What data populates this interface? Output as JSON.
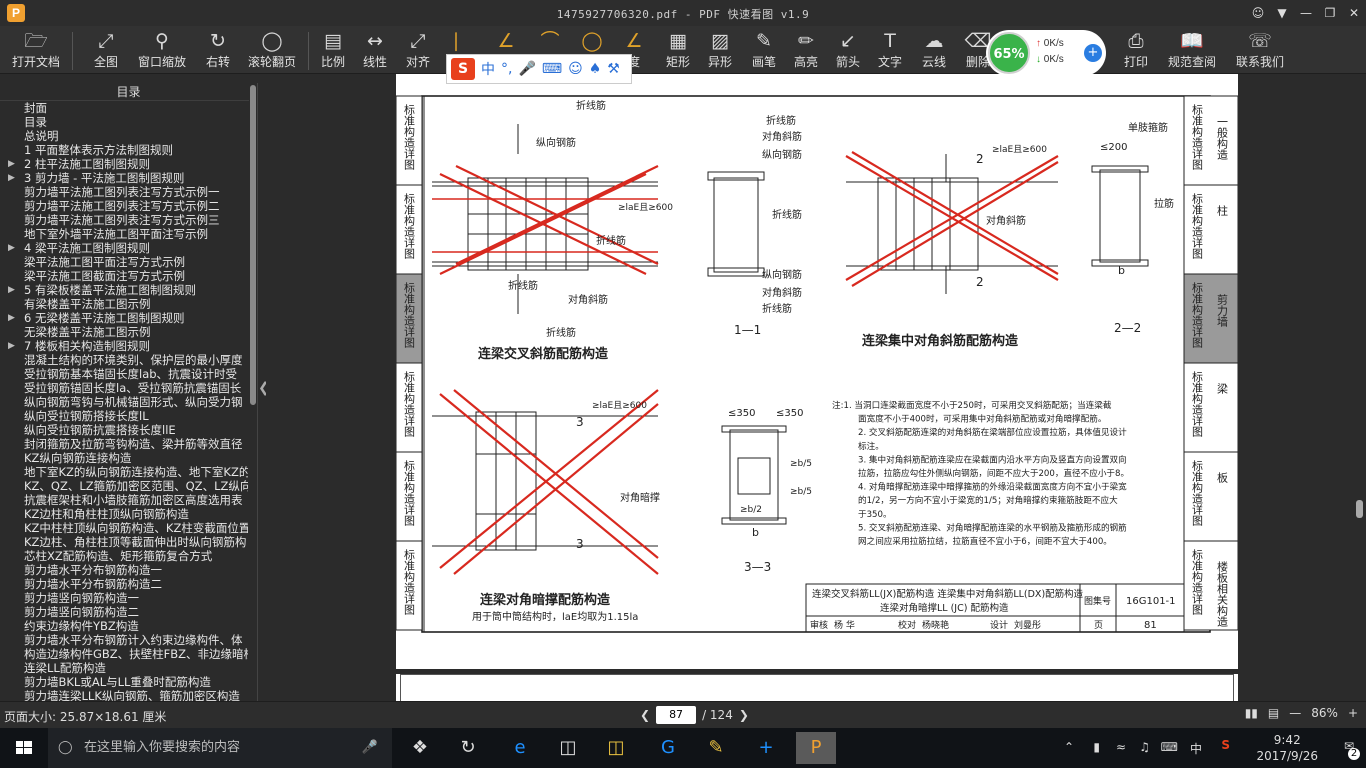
{
  "window": {
    "title": "1475927706320.pdf - PDF 快速看图 v1.9",
    "app_icon_letter": "P"
  },
  "toolbar": {
    "open": "打开文档",
    "fit": "全图",
    "window_zoom": "窗口缩放",
    "rotate": "右转",
    "scroll_page": "滚轮翻页",
    "scale": "比例",
    "linear": "线性",
    "align": "对齐",
    "degree": "度",
    "rect": "矩形",
    "shape": "异形",
    "pen": "画笔",
    "highlight": "高亮",
    "arrow": "箭头",
    "text": "文字",
    "cloud": "云线",
    "delete": "删除",
    "print": "打印",
    "spec": "规范查阅",
    "contact": "联系我们"
  },
  "ime": {
    "label": "中"
  },
  "net_widget": {
    "percent": "65%",
    "up": "0K/s",
    "down": "0K/s"
  },
  "sidebar": {
    "header": "目录",
    "items": [
      {
        "label": "封面",
        "arrow": ""
      },
      {
        "label": "目录",
        "arrow": ""
      },
      {
        "label": "总说明",
        "arrow": ""
      },
      {
        "label": "1 平面整体表示方法制图规则",
        "arrow": ""
      },
      {
        "label": "2 柱平法施工图制图规则",
        "arrow": "▶"
      },
      {
        "label": "3 剪力墙 - 平法施工图制图规则",
        "arrow": "▶"
      },
      {
        "label": "剪力墙平法施工图列表注写方式示例一",
        "arrow": ""
      },
      {
        "label": "剪力墙平法施工图列表注写方式示例二",
        "arrow": ""
      },
      {
        "label": "剪力墙平法施工图列表注写方式示例三",
        "arrow": ""
      },
      {
        "label": "地下室外墙平法施工图平面注写示例",
        "arrow": ""
      },
      {
        "label": "4 梁平法施工图制图规则",
        "arrow": "▶"
      },
      {
        "label": "梁平法施工图平面注写方式示例",
        "arrow": ""
      },
      {
        "label": "梁平法施工图截面注写方式示例",
        "arrow": ""
      },
      {
        "label": "5 有梁板楼盖平法施工图制图规则",
        "arrow": "▶"
      },
      {
        "label": "有梁楼盖平法施工图示例",
        "arrow": ""
      },
      {
        "label": "6 无梁楼盖平法施工图制图规则",
        "arrow": "▶"
      },
      {
        "label": "无梁楼盖平法施工图示例",
        "arrow": ""
      },
      {
        "label": "7 楼板相关构造制图规则",
        "arrow": "▶"
      },
      {
        "label": "混凝土结构的环境类别、保护层的最小厚度",
        "arrow": ""
      },
      {
        "label": "受拉钢筋基本锚固长度lab、抗震设计时受",
        "arrow": ""
      },
      {
        "label": "受拉钢筋锚固长度la、受拉钢筋抗震锚固长",
        "arrow": ""
      },
      {
        "label": "纵向钢筋弯钩与机械锚固形式、纵向受力钢",
        "arrow": ""
      },
      {
        "label": "纵向受拉钢筋搭接长度lL",
        "arrow": ""
      },
      {
        "label": "纵向受拉钢筋抗震搭接长度llE",
        "arrow": ""
      },
      {
        "label": "封闭箍筋及拉筋弯钩构造、梁并筋等效直径",
        "arrow": ""
      },
      {
        "label": "KZ纵向钢筋连接构造",
        "arrow": ""
      },
      {
        "label": "地下室KZ的纵向钢筋连接构造、地下室KZ的",
        "arrow": ""
      },
      {
        "label": "KZ、QZ、LZ箍筋加密区范围、QZ、LZ纵向钢",
        "arrow": ""
      },
      {
        "label": "抗震框架柱和小墙肢箍筋加密区高度选用表",
        "arrow": ""
      },
      {
        "label": "KZ边柱和角柱柱顶纵向钢筋构造",
        "arrow": ""
      },
      {
        "label": "KZ中柱柱顶纵向钢筋构造、KZ柱变截面位置",
        "arrow": ""
      },
      {
        "label": "KZ边柱、角柱柱顶等截面伸出时纵向钢筋构",
        "arrow": ""
      },
      {
        "label": "芯柱XZ配筋构造、矩形箍筋复合方式",
        "arrow": ""
      },
      {
        "label": "剪力墙水平分布钢筋构造一",
        "arrow": ""
      },
      {
        "label": "剪力墙水平分布钢筋构造二",
        "arrow": ""
      },
      {
        "label": "剪力墙竖向钢筋构造一",
        "arrow": ""
      },
      {
        "label": "剪力墙竖向钢筋构造二",
        "arrow": ""
      },
      {
        "label": "约束边缘构件YBZ构造",
        "arrow": ""
      },
      {
        "label": "剪力墙水平分布钢筋计入约束边缘构件、体",
        "arrow": ""
      },
      {
        "label": "构造边缘构件GBZ、扶壁柱FBZ、非边缘暗柱",
        "arrow": ""
      },
      {
        "label": "连梁LL配筋构造",
        "arrow": ""
      },
      {
        "label": "剪力墙BKL或AL与LL重叠时配筋构造",
        "arrow": ""
      },
      {
        "label": "剪力墙连梁LLK纵向钢筋、箍筋加密区构造",
        "arrow": ""
      }
    ]
  },
  "page": {
    "left_tabs": [
      "标准构造详图",
      "标准构造详图",
      "标准构造详图",
      "标准构造详图",
      "标准构造详图",
      "标准构造详图"
    ],
    "right_tabs": [
      {
        "vertical": "标准构造详图",
        "name": "一般构造"
      },
      {
        "vertical": "标准构造详图",
        "name": "柱"
      },
      {
        "vertical": "标准构造详图",
        "name": "剪力墙"
      },
      {
        "vertical": "标准构造详图",
        "name": "梁"
      },
      {
        "vertical": "标准构造详图",
        "name": "板"
      },
      {
        "vertical": "标准构造详图",
        "name": "楼板相关构造"
      }
    ],
    "labels": {
      "zhexianjin": "折线筋",
      "zongxiang": "纵向钢筋",
      "duijiao": "对角斜筋",
      "duijiao_an": "对角暗撑",
      "dan_zhi": "单肢箍筋",
      "la_jin": "拉筋",
      "cap1": "连梁交叉斜筋配筋构造",
      "cap2": "连梁集中对角斜筋配筋构造",
      "cap3": "连梁对角暗撑配筋构造",
      "cap3_note": "用于筒中筒结构时，laE均取为1.15la",
      "sec1": "1—1",
      "sec2": "2—2",
      "sec3": "3—3",
      "dim_600": "≥laE且≥600",
      "dim_200": "≤200",
      "dim_350": "≤350",
      "b": "b",
      "num1": "1",
      "num2": "2",
      "num3": "3",
      "b2": "≥b/2",
      "b5": "≥b/5"
    },
    "notes": [
      "注:1. 当洞口连梁截面宽度不小于250时，可采用交叉斜筋配筋；当连梁截",
      "面宽度不小于400时，可采用集中对角斜筋配筋或对角暗撑配筋。",
      "2. 交叉斜筋配筋连梁的对角斜筋在梁端部位应设置拉筋，具体值见设计",
      "标注。",
      "3. 集中对角斜筋配筋连梁应在梁截面内沿水平方向及竖直方向设置双向",
      "拉筋，拉筋应勾住外侧纵向钢筋，间距不应大于200，直径不应小于8。",
      "4. 对角暗撑配筋连梁中暗撑箍筋的外缘沿梁截面宽度方向不宜小于梁宽",
      "的1/2，另一方向不宜小于梁宽的1/5；对角暗撑约束箍筋肢距不应大",
      "于350。",
      "5. 交叉斜筋配筋连梁、对角暗撑配筋连梁的水平钢筋及箍筋形成的钢筋",
      "网之间应采用拉筋拉结，拉筋直径不宜小于6，间距不宜大于400。"
    ],
    "titleblock": {
      "line1": "连梁交叉斜筋LL(JX)配筋构造  连梁集中对角斜筋LL(DX)配筋构造",
      "line2": "连梁对角暗撑LL (JC) 配筋构造",
      "atlas_label": "图集号",
      "atlas_no": "16G101-1",
      "review": "审核",
      "reviewer": "杨 华",
      "check": "校对",
      "checker": "杨晓艳",
      "design": "设计",
      "designer": "刘曼彤",
      "page_label": "页",
      "page_no": "81"
    }
  },
  "status": {
    "page_size": "页面大小: 25.87×18.61 厘米",
    "current_page": "87",
    "total_pages": "/ 124",
    "zoom": "86%"
  },
  "taskbar": {
    "search_placeholder": "在这里输入你要搜索的内容",
    "ime": "中",
    "time": "9:42",
    "date": "2017/9/26",
    "notif_count": "2"
  }
}
